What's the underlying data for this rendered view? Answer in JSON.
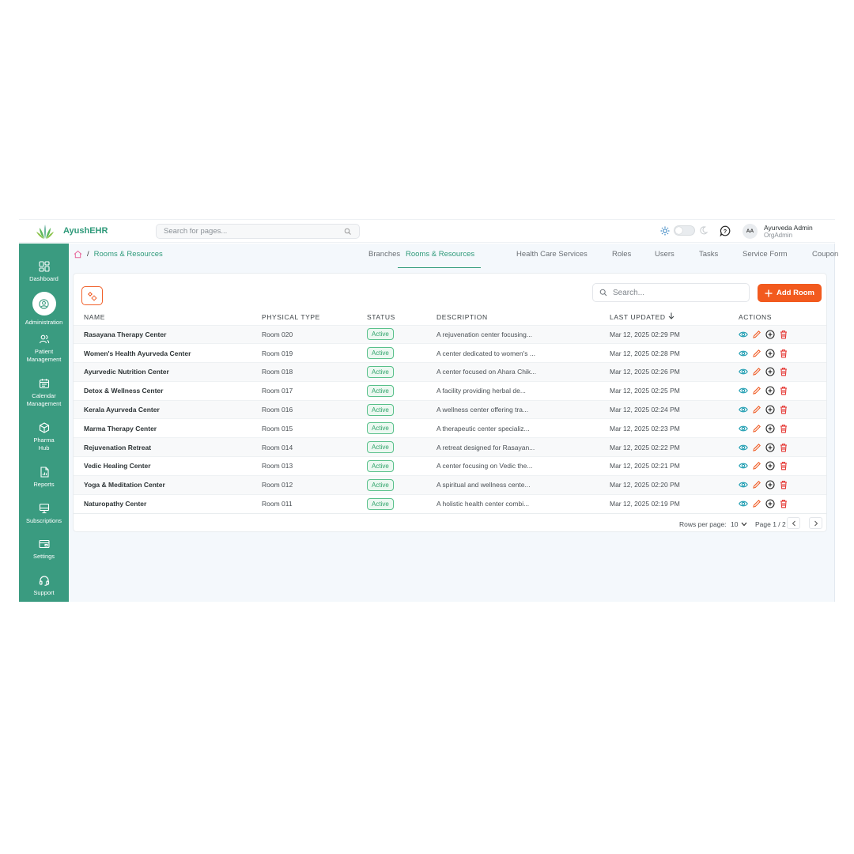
{
  "app": {
    "brand": "AyushEHR",
    "search_placeholder": "Search for pages...",
    "user": {
      "initials": "AA",
      "name": "Ayurveda Admin",
      "role": "OrgAdmin"
    }
  },
  "sidebar": {
    "items": [
      {
        "label": "Dashboard",
        "icon": "dashboard-icon"
      },
      {
        "label": "Administration",
        "icon": "admin-icon",
        "active": true
      },
      {
        "label": "Patient Management",
        "icon": "patients-icon"
      },
      {
        "label": "Calendar Management",
        "icon": "calendar-icon"
      },
      {
        "label": "Pharma Hub",
        "icon": "package-icon"
      },
      {
        "label": "Reports",
        "icon": "report-icon"
      },
      {
        "label": "Subscriptions",
        "icon": "monitor-icon"
      },
      {
        "label": "Settings",
        "icon": "card-icon"
      },
      {
        "label": "Support",
        "icon": "headset-icon"
      }
    ]
  },
  "breadcrumb": {
    "current": "Rooms & Resources",
    "separator": "/"
  },
  "tabs": [
    "Branches",
    "Rooms & Resources",
    "Health Care Services",
    "Roles",
    "Users",
    "Tasks",
    "Service Form",
    "Coupon"
  ],
  "toolbar": {
    "search_placeholder": "Search...",
    "add_label": "Add Room"
  },
  "table": {
    "headers": [
      "NAME",
      "PHYSICAL TYPE",
      "STATUS",
      "DESCRIPTION",
      "LAST UPDATED",
      "ACTIONS"
    ],
    "rows": [
      {
        "name": "Rasayana Therapy Center",
        "type": "Room 020",
        "status": "Active",
        "desc": "A rejuvenation center focusing...",
        "updated": "Mar 12, 2025 02:29 PM"
      },
      {
        "name": "Women's Health Ayurveda Center",
        "type": "Room 019",
        "status": "Active",
        "desc": "A center dedicated to women's ...",
        "updated": "Mar 12, 2025 02:28 PM"
      },
      {
        "name": "Ayurvedic Nutrition Center",
        "type": "Room 018",
        "status": "Active",
        "desc": "A center focused on Ahara Chik...",
        "updated": "Mar 12, 2025 02:26 PM"
      },
      {
        "name": "Detox & Wellness Center",
        "type": "Room 017",
        "status": "Active",
        "desc": "A facility providing herbal de...",
        "updated": "Mar 12, 2025 02:25 PM"
      },
      {
        "name": "Kerala Ayurveda Center",
        "type": "Room 016",
        "status": "Active",
        "desc": "A wellness center offering tra...",
        "updated": "Mar 12, 2025 02:24 PM"
      },
      {
        "name": "Marma Therapy Center",
        "type": "Room 015",
        "status": "Active",
        "desc": "A therapeutic center specializ...",
        "updated": "Mar 12, 2025 02:23 PM"
      },
      {
        "name": "Rejuvenation Retreat",
        "type": "Room 014",
        "status": "Active",
        "desc": "A retreat designed for Rasayan...",
        "updated": "Mar 12, 2025 02:22 PM"
      },
      {
        "name": "Vedic Healing Center",
        "type": "Room 013",
        "status": "Active",
        "desc": "A center focusing on Vedic the...",
        "updated": "Mar 12, 2025 02:21 PM"
      },
      {
        "name": "Yoga & Meditation Center",
        "type": "Room 012",
        "status": "Active",
        "desc": "A spiritual and wellness cente...",
        "updated": "Mar 12, 2025 02:20 PM"
      },
      {
        "name": "Naturopathy Center",
        "type": "Room 011",
        "status": "Active",
        "desc": "A holistic health center combi...",
        "updated": "Mar 12, 2025 02:19 PM"
      }
    ]
  },
  "pagination": {
    "rows_label": "Rows per page:",
    "rows_value": "10",
    "page_label": "Page 1 / 2"
  },
  "colors": {
    "primary": "#3a9b80",
    "accent": "#f25a1e",
    "active_badge": "#2fa36a",
    "view": "#1a9bb0",
    "edit": "#f0602a",
    "delete": "#e53935"
  }
}
